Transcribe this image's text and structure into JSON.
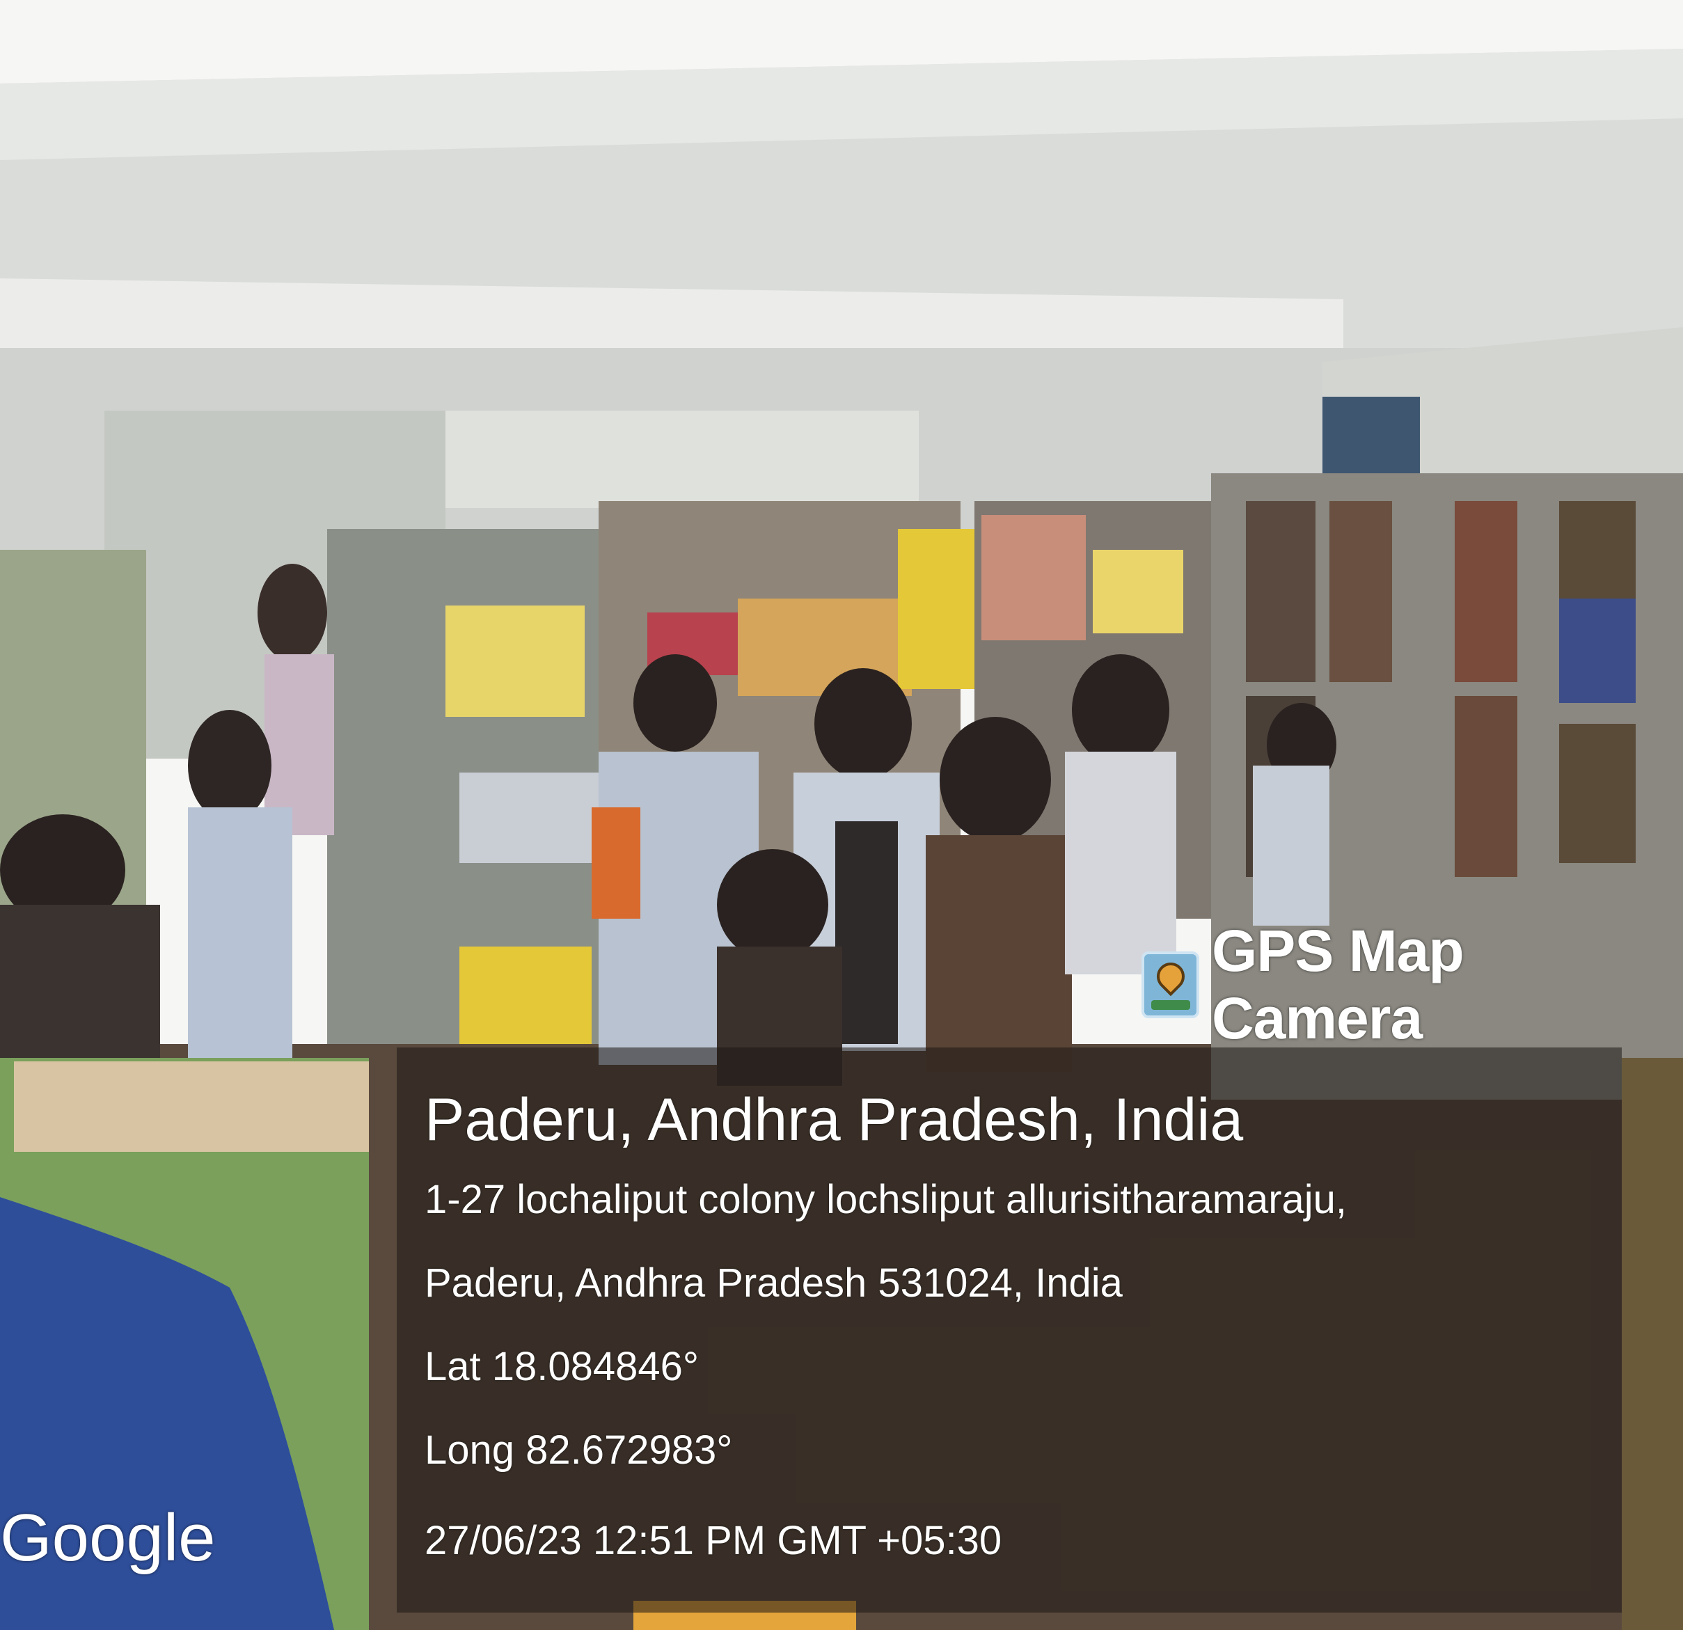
{
  "overlay": {
    "app_name": "GPS Map Camera",
    "city": "Paderu, Andhra Pradesh, India",
    "address_line1": "1-27 lochaliput colony lochsliput allurisitharamaraju,",
    "address_line2": "Paderu, Andhra Pradesh 531024, India",
    "latitude": "Lat 18.084846°",
    "longitude": "Long 82.672983°",
    "timestamp": "27/06/23 12:51 PM GMT +05:30",
    "map_brand": "Google",
    "icon": "gps-map-camera-icon"
  }
}
